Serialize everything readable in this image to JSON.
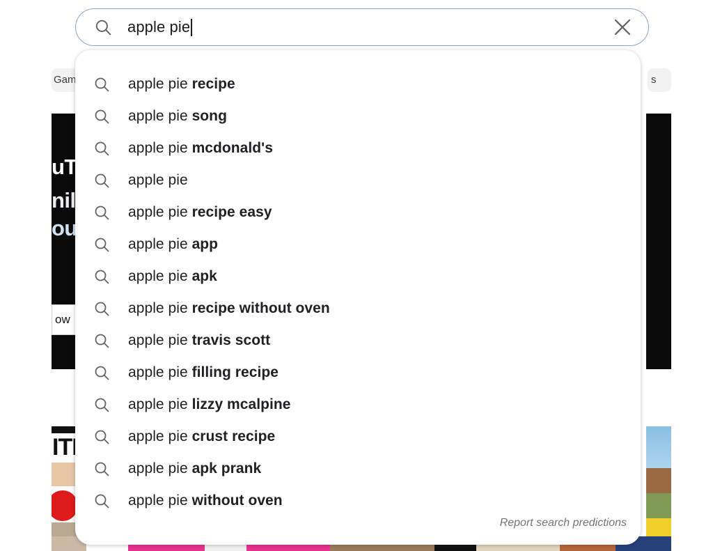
{
  "search": {
    "value": "apple pie",
    "search_icon": "search-icon",
    "clear_icon": "close-icon",
    "border_color": "#8ba4c4"
  },
  "suggestions": {
    "prefix": "apple pie",
    "items": [
      {
        "prefix": "apple pie ",
        "rest": "recipe",
        "full": "apple pie recipe"
      },
      {
        "prefix": "apple pie ",
        "rest": "song",
        "full": "apple pie song"
      },
      {
        "prefix": "apple pie ",
        "rest": "mcdonald's",
        "full": "apple pie mcdonald's"
      },
      {
        "prefix": "apple pie",
        "rest": "",
        "full": "apple pie"
      },
      {
        "prefix": "apple pie ",
        "rest": "recipe easy",
        "full": "apple pie recipe easy"
      },
      {
        "prefix": "apple pie ",
        "rest": "app",
        "full": "apple pie app"
      },
      {
        "prefix": "apple pie ",
        "rest": "apk",
        "full": "apple pie apk"
      },
      {
        "prefix": "apple pie ",
        "rest": "recipe without oven",
        "full": "apple pie recipe without oven"
      },
      {
        "prefix": "apple pie ",
        "rest": "travis scott",
        "full": "apple pie travis scott"
      },
      {
        "prefix": "apple pie ",
        "rest": "filling recipe",
        "full": "apple pie filling recipe"
      },
      {
        "prefix": "apple pie ",
        "rest": "lizzy mcalpine",
        "full": "apple pie lizzy mcalpine"
      },
      {
        "prefix": "apple pie ",
        "rest": "crust recipe",
        "full": "apple pie crust recipe"
      },
      {
        "prefix": "apple pie ",
        "rest": "apk prank",
        "full": "apple pie apk prank"
      },
      {
        "prefix": "apple pie ",
        "rest": "without oven",
        "full": "apple pie without oven"
      }
    ],
    "report_label": "Report search predictions",
    "row_icon": "search-icon"
  },
  "background": {
    "chip_left": "Gam",
    "chip_right": "s",
    "card_text_line1": "uTu",
    "card_text_line2": "nily",
    "card_text_line3": "ou",
    "button_label": "ow",
    "thumb_letters": "ITI"
  }
}
